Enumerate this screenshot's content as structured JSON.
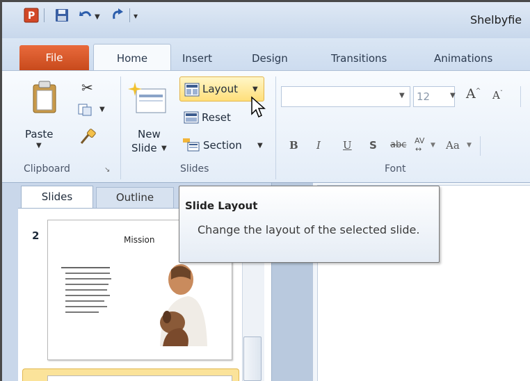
{
  "window": {
    "title": "Shelbyfie"
  },
  "tabs": [
    {
      "label": "File"
    },
    {
      "label": "Home"
    },
    {
      "label": "Insert"
    },
    {
      "label": "Design"
    },
    {
      "label": "Transitions"
    },
    {
      "label": "Animations"
    }
  ],
  "clipboard": {
    "paste_label": "Paste",
    "group_label": "Clipboard"
  },
  "slides_group": {
    "new_slide_line1": "New",
    "new_slide_line2": "Slide",
    "layout_label": "Layout",
    "reset_label": "Reset",
    "section_label": "Section",
    "group_label": "Slides"
  },
  "font_group": {
    "font_name_value": "",
    "font_size_value": "12",
    "group_label": "Font",
    "bold": "B",
    "italic": "I",
    "underline": "U",
    "shadow": "S",
    "strikethrough": "abc",
    "spacing": "AV",
    "change_case": "Aa"
  },
  "pane_tabs": {
    "slides": "Slides",
    "outline": "Outline"
  },
  "thumbnail": {
    "number": "2",
    "title": "Mission"
  },
  "tooltip": {
    "title": "Slide Layout",
    "description": "Change the layout of the selected slide."
  },
  "colors": {
    "file_tab": "#d4582a",
    "layout_highlight": "#ffe38a",
    "ribbon": "#eef3fa"
  }
}
